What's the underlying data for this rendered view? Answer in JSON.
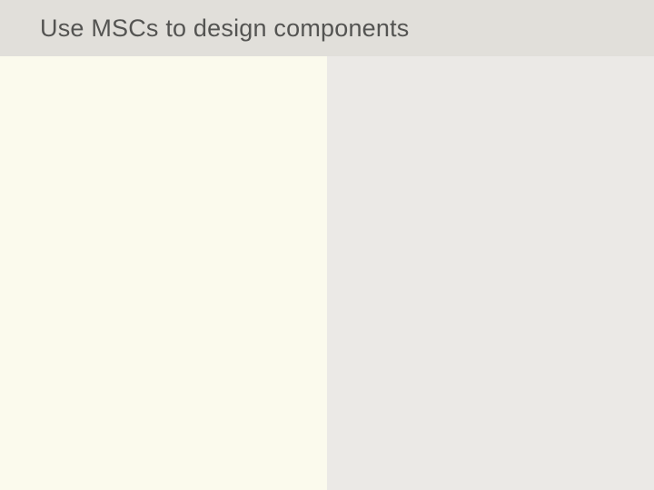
{
  "slide": {
    "title": "Use MSCs to design components"
  }
}
